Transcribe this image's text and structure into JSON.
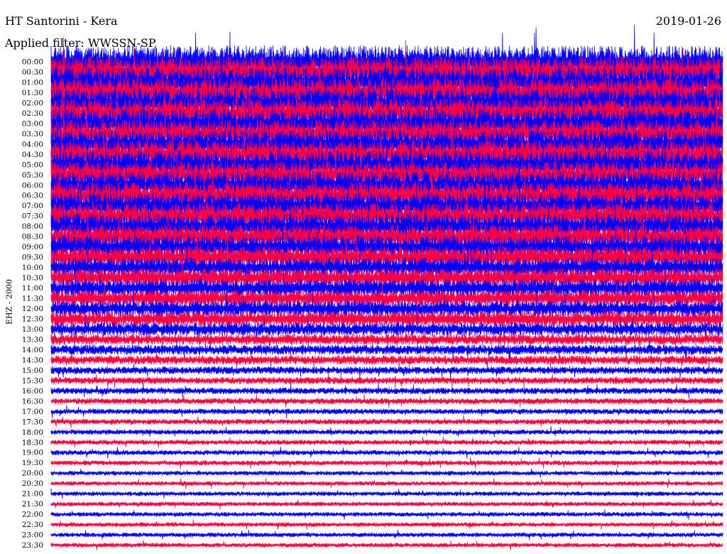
{
  "header": {
    "station": "HT Santorini - Kera",
    "date": "2019-01-26",
    "filter": "Applied filter: WWSSN-SP"
  },
  "chart_data": {
    "type": "line",
    "title": "HT Santorini - Kera",
    "subtitle": "Applied filter: WWSSN-SP",
    "date": "2019-01-26",
    "ylabel": "EHZ - 2000",
    "xlabel": "",
    "grid": false,
    "y_tick_labels": [
      "00:00",
      "00:30",
      "01:00",
      "01:30",
      "02:00",
      "02:30",
      "03:00",
      "03:30",
      "04:00",
      "04:30",
      "05:00",
      "05:30",
      "06:00",
      "06:30",
      "07:00",
      "07:30",
      "08:00",
      "08:30",
      "09:00",
      "09:30",
      "10:00",
      "10:30",
      "11:00",
      "11:30",
      "12:00",
      "12:30",
      "13:00",
      "13:30",
      "14:00",
      "14:30",
      "15:00",
      "15:30",
      "16:00",
      "16:30",
      "17:00",
      "17:30",
      "18:00",
      "18:30",
      "19:00",
      "19:30",
      "20:00",
      "20:30",
      "21:00",
      "21:30",
      "22:00",
      "22:30",
      "23:00",
      "23:30"
    ],
    "series_colors": [
      "#ff0040",
      "#0000ff"
    ],
    "relative_noise_amplitude": [
      3.2,
      3.1,
      3.0,
      3.0,
      2.9,
      2.9,
      2.9,
      2.8,
      2.8,
      2.8,
      2.8,
      2.7,
      2.7,
      2.7,
      2.6,
      2.6,
      2.5,
      2.4,
      2.3,
      2.2,
      2.0,
      1.9,
      1.8,
      1.7,
      1.6,
      1.5,
      1.3,
      1.1,
      1.0,
      0.9,
      0.75,
      0.7,
      0.65,
      0.6,
      0.55,
      0.55,
      0.5,
      0.5,
      0.5,
      0.5,
      0.45,
      0.45,
      0.45,
      0.45,
      0.45,
      0.45,
      0.45,
      0.45
    ]
  }
}
